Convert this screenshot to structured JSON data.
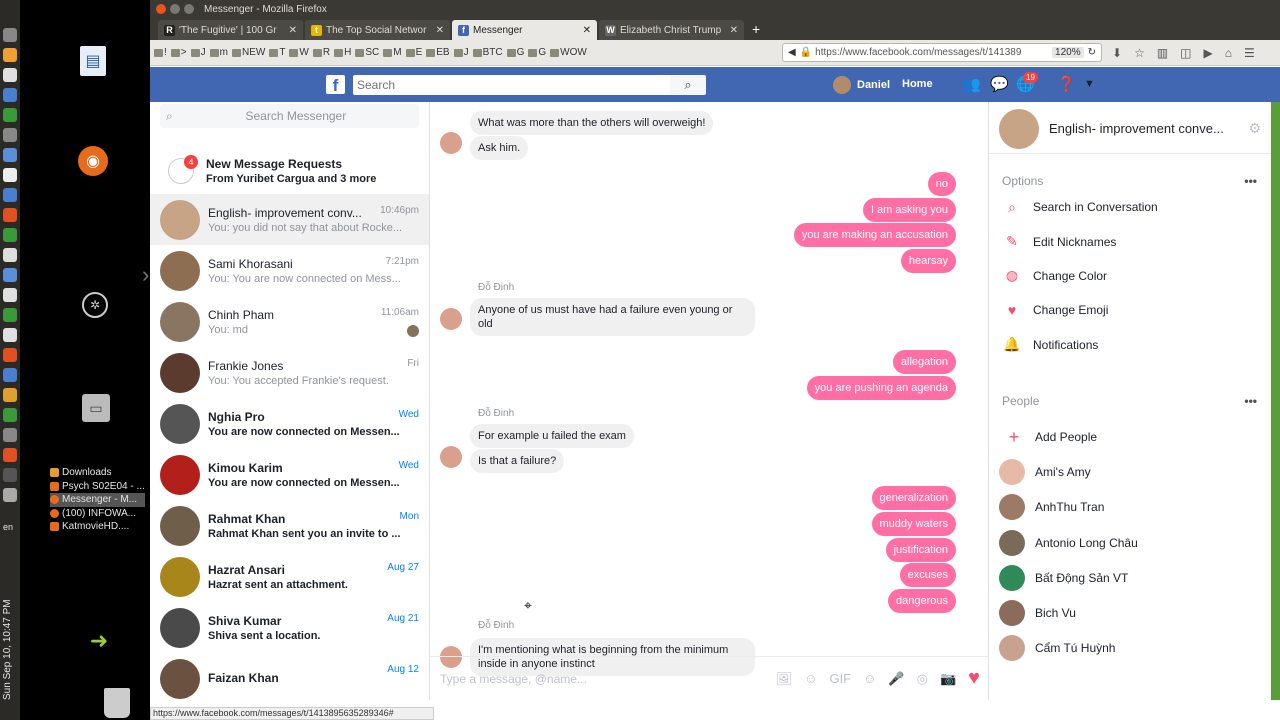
{
  "window": {
    "title": "Messenger - Mozilla Firefox"
  },
  "tabs": [
    {
      "label": "'The Fugitive' | 100 Gr",
      "fav": "R",
      "color": "#222",
      "active": false
    },
    {
      "label": "The Top Social Networ",
      "fav": "t",
      "color": "#e8b600",
      "active": false
    },
    {
      "label": "Messenger",
      "fav": "f",
      "color": "#4267b2",
      "active": true
    },
    {
      "label": "Elizabeth Christ Trump",
      "fav": "W",
      "color": "#666",
      "active": false
    }
  ],
  "bookmarks": [
    "!",
    ">",
    "J",
    "m",
    "NEW",
    "T",
    "W",
    "R",
    "H",
    "SC",
    "M",
    "E",
    "EB",
    "J",
    "BTC",
    "G",
    "G",
    "WOW"
  ],
  "url": {
    "text": "https://www.facebook.com/messages/t/141389",
    "zoom": "120%"
  },
  "fb_header": {
    "search_placeholder": "Search",
    "user_name": "Daniel",
    "home_label": "Home",
    "notification_count": "19"
  },
  "left": {
    "search_placeholder": "Search Messenger",
    "requests": {
      "title": "New Message Requests",
      "subtitle": "From Yuribet Cargua and 3 more",
      "badge": "4"
    },
    "conversations": [
      {
        "name": "English- improvement conv...",
        "snippet": "You: you did not say that about Rocke...",
        "time": "10:46pm",
        "unread": false,
        "active": true,
        "color": "#c7a486"
      },
      {
        "name": "Sami Khorasani",
        "snippet": "You: You are now connected on Mess...",
        "time": "7:21pm",
        "unread": false,
        "active": false,
        "color": "#8d6e52"
      },
      {
        "name": "Chinh Pham",
        "snippet": "You: md",
        "time": "11:06am",
        "unread": false,
        "active": false,
        "color": "#8a7462"
      },
      {
        "name": "Frankie Jones",
        "snippet": "You: You accepted Frankie's request.",
        "time": "Fri",
        "unread": false,
        "active": false,
        "color": "#5a3b2e"
      },
      {
        "name": "Nghia Pro",
        "snippet": "You are now connected on Messen...",
        "time": "Wed",
        "unread": true,
        "active": false,
        "color": "#555555"
      },
      {
        "name": "Kimou Karim",
        "snippet": "You are now connected on Messen...",
        "time": "Wed",
        "unread": true,
        "active": false,
        "color": "#b3201c"
      },
      {
        "name": "Rahmat Khan",
        "snippet": "Rahmat Khan sent you an invite to ...",
        "time": "Mon",
        "unread": true,
        "active": false,
        "color": "#6f5f4a"
      },
      {
        "name": "Hazrat Ansari",
        "snippet": "Hazrat sent an attachment.",
        "time": "Aug 27",
        "unread": true,
        "active": false,
        "color": "#a8861a"
      },
      {
        "name": "Shiva Kumar",
        "snippet": "Shiva sent a location.",
        "time": "Aug 21",
        "unread": true,
        "active": false,
        "color": "#4a4a4a"
      },
      {
        "name": "Faizan Khan",
        "snippet": "",
        "time": "Aug 12",
        "unread": true,
        "active": false,
        "color": "#6b5140"
      }
    ]
  },
  "chat": {
    "sender_name": "Đỗ Đinh",
    "messages": [
      {
        "dir": "in",
        "text": "What was more than the others will overweigh!"
      },
      {
        "dir": "in",
        "text": "Ask him."
      },
      {
        "dir": "out",
        "text": "no"
      },
      {
        "dir": "out",
        "text": "I am asking you"
      },
      {
        "dir": "out",
        "text": "you are making an accusation"
      },
      {
        "dir": "out",
        "text": "hearsay"
      },
      {
        "dir": "in",
        "text": "Anyone of us must have had a failure even young or old"
      },
      {
        "dir": "out",
        "text": "allegation"
      },
      {
        "dir": "out",
        "text": "you are pushing an agenda"
      },
      {
        "dir": "in",
        "text": "For example u failed the exam"
      },
      {
        "dir": "in",
        "text": "Is that a failure?"
      },
      {
        "dir": "out",
        "text": "generalization"
      },
      {
        "dir": "out",
        "text": "muddy waters"
      },
      {
        "dir": "out",
        "text": "justification"
      },
      {
        "dir": "out",
        "text": "excuses"
      },
      {
        "dir": "out",
        "text": "dangerous"
      },
      {
        "dir": "in",
        "text": "I'm mentioning what is beginning from the minimum inside in anyone instinct"
      }
    ],
    "compose_placeholder": "Type a message, @name..."
  },
  "right": {
    "title": "English- improvement conve...",
    "options_label": "Options",
    "options": [
      {
        "label": "Search in Conversation",
        "icon": "search-icon"
      },
      {
        "label": "Edit Nicknames",
        "icon": "pencil-icon"
      },
      {
        "label": "Change Color",
        "icon": "palette-icon"
      },
      {
        "label": "Change Emoji",
        "icon": "heart-icon"
      },
      {
        "label": "Notifications",
        "icon": "bell-icon"
      }
    ],
    "people_label": "People",
    "add_people": "Add People",
    "people": [
      {
        "name": "Ami's Amy",
        "color": "#e7b9a8"
      },
      {
        "name": "AnhThu Tran",
        "color": "#9b7a66"
      },
      {
        "name": "Antonio Long Châu",
        "color": "#7a6a58"
      },
      {
        "name": "Bất Động Sản VT",
        "color": "#2e8b57"
      },
      {
        "name": "Bich Vu",
        "color": "#8a6b5c"
      },
      {
        "name": "Cẩm Tú Huỳnh",
        "color": "#c9a190"
      }
    ]
  },
  "statusbar": {
    "text": "https://www.facebook.com/messages/t/1413895635289346#"
  },
  "desktop": {
    "recent": [
      "Downloads",
      "Psych S02E04 - ...",
      "Messenger - M...",
      "(100) INFOWA...",
      "KatmovieHD...."
    ],
    "clock": "Sun Sep 10, 10:47 PM",
    "lang": "en"
  }
}
